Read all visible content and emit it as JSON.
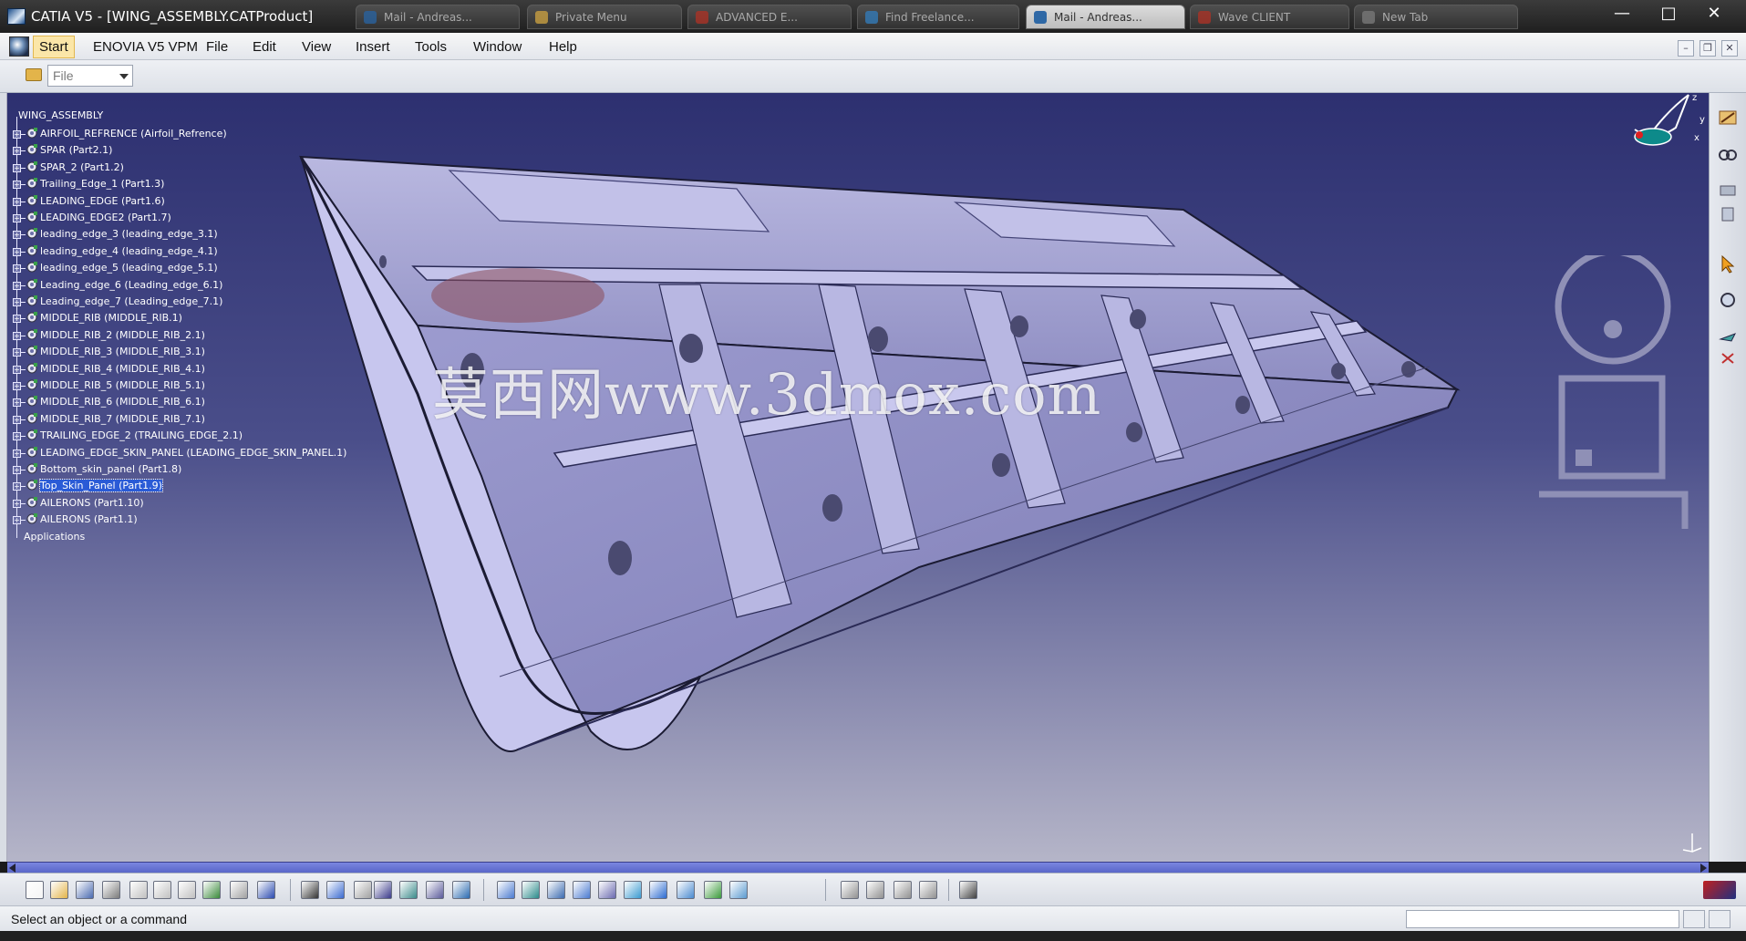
{
  "window": {
    "title": "CATIA V5 - [WING_ASSEMBLY.CATProduct]",
    "controls": {
      "minimize": "—",
      "maximize": "□",
      "close": "✕"
    }
  },
  "background_tabs": [
    {
      "label": "Mail - Andreas...",
      "color": "#2f6fb3"
    },
    {
      "label": "Private Menu",
      "color": "#e3b44a"
    },
    {
      "label": "ADVANCED E...",
      "color": "#c0392b"
    },
    {
      "label": "Find Freelance...",
      "color": "#3a8bd0"
    },
    {
      "label": "Mail - Andreas...",
      "color": "#2f6fb3"
    },
    {
      "label": "Wave CLIENT",
      "color": "#c0392b"
    },
    {
      "label": "New Tab",
      "color": "#888888"
    }
  ],
  "menubar": {
    "start": "Start",
    "items": [
      "ENOVIA V5 VPM",
      "File",
      "Edit",
      "View",
      "Insert",
      "Tools",
      "Window",
      "Help"
    ],
    "mdi": {
      "minimize": "–",
      "restore": "❐",
      "close": "✕"
    }
  },
  "filebar": {
    "combo_value": "File"
  },
  "tree": {
    "root": "WING_ASSEMBLY",
    "nodes": [
      "AIRFOIL_REFRENCE (Airfoil_Refrence)",
      "SPAR (Part2.1)",
      "SPAR_2 (Part1.2)",
      "Trailing_Edge_1 (Part1.3)",
      "LEADING_EDGE (Part1.6)",
      "LEADING_EDGE2 (Part1.7)",
      "leading_edge_3 (leading_edge_3.1)",
      "leading_edge_4 (leading_edge_4.1)",
      "leading_edge_5 (leading_edge_5.1)",
      "Leading_edge_6 (Leading_edge_6.1)",
      "Leading_edge_7 (Leading_edge_7.1)",
      "MIDDLE_RIB (MIDDLE_RIB.1)",
      "MIDDLE_RIB_2 (MIDDLE_RIB_2.1)",
      "MIDDLE_RIB_3 (MIDDLE_RIB_3.1)",
      "MIDDLE_RIB_4 (MIDDLE_RIB_4.1)",
      "MIDDLE_RIB_5 (MIDDLE_RIB_5.1)",
      "MIDDLE_RIB_6 (MIDDLE_RIB_6.1)",
      "MIDDLE_RIB_7 (MIDDLE_RIB_7.1)",
      "TRAILING_EDGE_2 (TRAILING_EDGE_2.1)",
      "LEADING_EDGE_SKIN_PANEL (LEADING_EDGE_SKIN_PANEL.1)",
      "Bottom_skin_panel (Part1.8)",
      "Top_Skin_Panel (Part1.9)",
      "AILERONS (Part1.10)",
      "AILERONS (Part1.1)"
    ],
    "selected_index": 21,
    "applications": "Applications"
  },
  "viewport": {
    "watermark": "莫西网www.3dmox.com",
    "compass_axes": {
      "x": "x",
      "y": "y",
      "z": "z"
    }
  },
  "statusbar": {
    "message": "Select an object or a command"
  },
  "colors": {
    "viewport_top": "#2d3070",
    "viewport_bottom": "#b5b5c8",
    "wing_fill": "#a9a8d6",
    "selection": "#2a5bd6"
  }
}
